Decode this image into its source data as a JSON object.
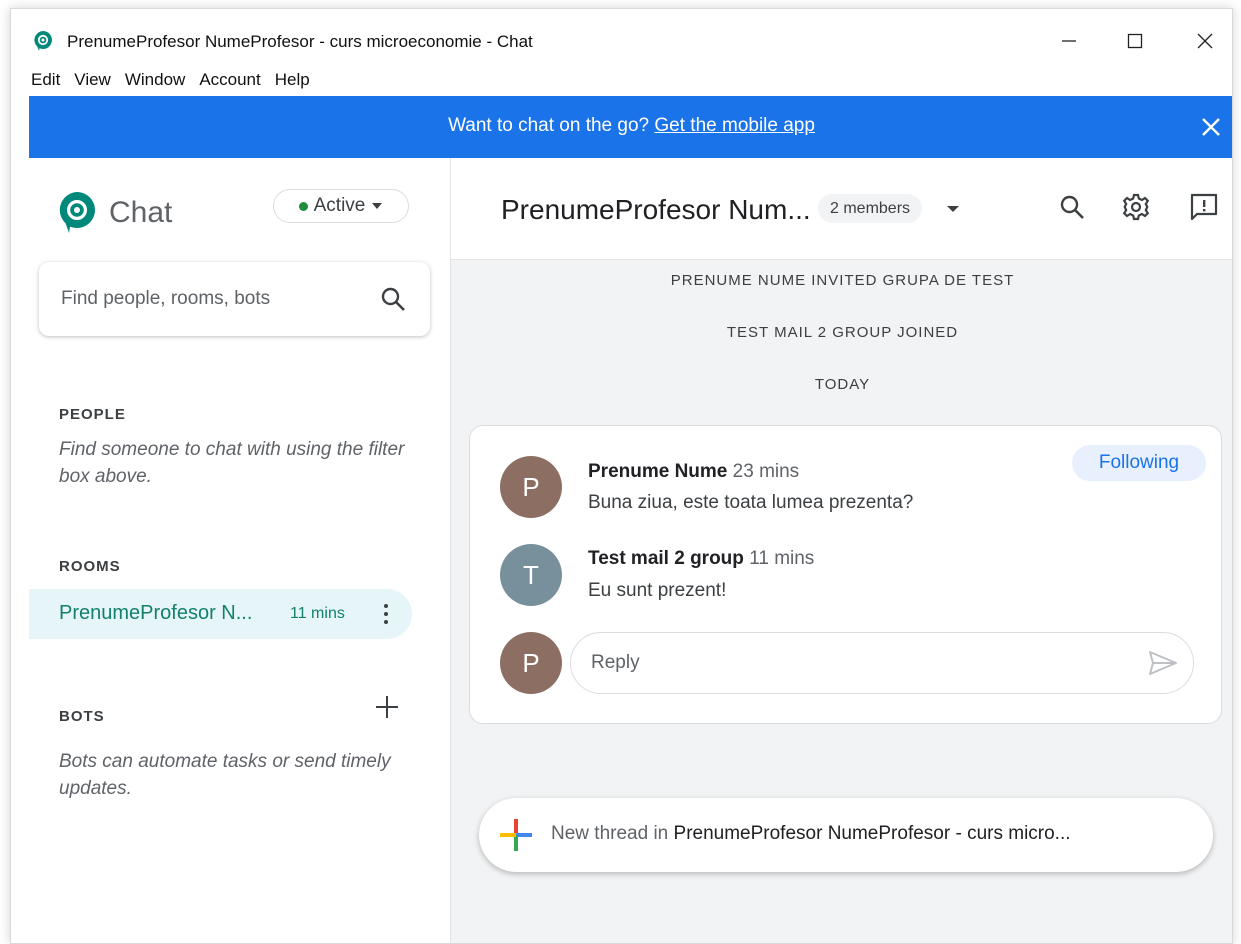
{
  "window": {
    "title": "PrenumeProfesor NumeProfesor - curs microeconomie - Chat",
    "minimize_icon": "minimize-icon",
    "maximize_icon": "maximize-icon",
    "close_icon": "close-icon"
  },
  "menu": [
    "Edit",
    "View",
    "Window",
    "Account",
    "Help"
  ],
  "banner": {
    "text": "Want to chat on the go?",
    "link": "Get the mobile app",
    "color": "#1a73e8"
  },
  "sidebar": {
    "app_name": "Chat",
    "status": "Active",
    "search_placeholder": "Find people, rooms, bots",
    "people_header": "PEOPLE",
    "people_hint": "Find someone to chat with using the filter box above.",
    "rooms_header": "ROOMS",
    "rooms": [
      {
        "name": "PrenumeProfesor N...",
        "time": "11 mins"
      }
    ],
    "bots_header": "BOTS",
    "bots_hint": "Bots can automate tasks or send timely updates."
  },
  "main": {
    "room_title": "PrenumeProfesor Num...",
    "members": "2 members",
    "system_messages": [
      "PRENUME NUME INVITED GRUPA DE TEST",
      "TEST MAIL 2 GROUP JOINED",
      "TODAY"
    ],
    "following": "Following",
    "messages": [
      {
        "initial": "P",
        "author": "Prenume Nume",
        "time": "23 mins",
        "text": "Buna ziua, este toata lumea prezenta?",
        "avatar_color": "#8d6e63"
      },
      {
        "initial": "T",
        "author": "Test mail 2 group",
        "time": "11 mins",
        "text": "Eu sunt prezent!",
        "avatar_color": "#78909c"
      }
    ],
    "reply_avatar": {
      "initial": "P",
      "color": "#8d6e63"
    },
    "reply_placeholder": "Reply",
    "new_thread_prefix": "New thread in",
    "new_thread_room": "PrenumeProfesor NumeProfesor - curs micro..."
  }
}
